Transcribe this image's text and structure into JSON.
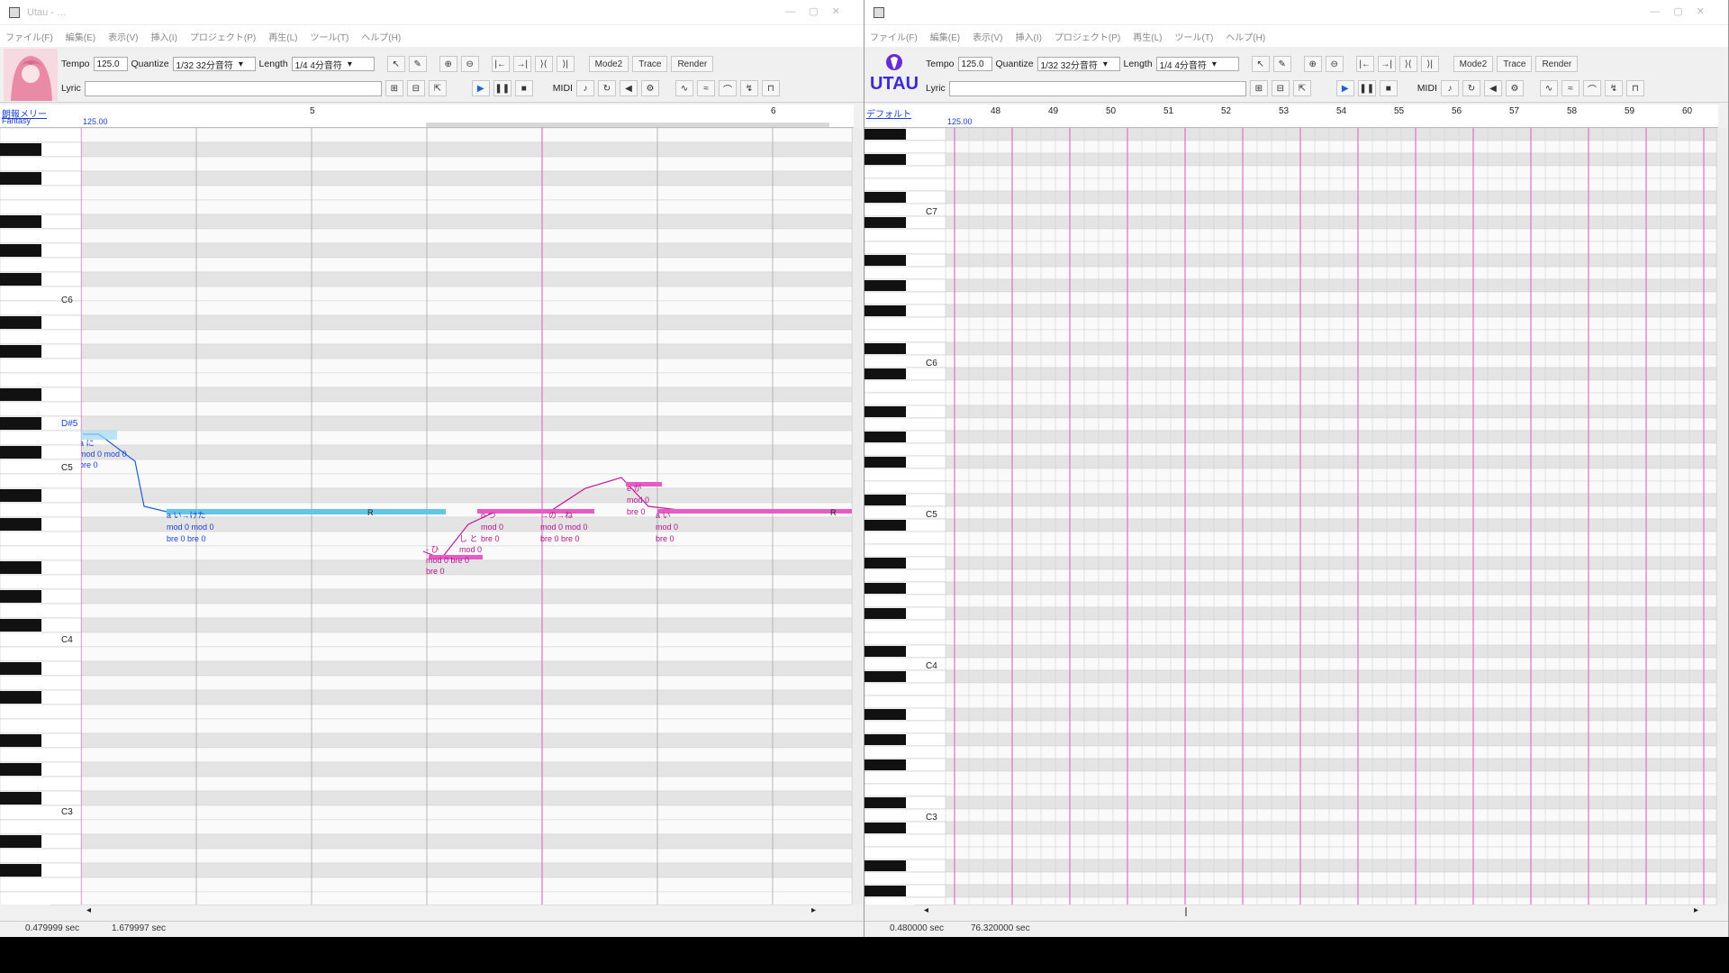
{
  "left": {
    "title": "Utau - …",
    "menu": [
      "ファイル(F)",
      "編集(E)",
      "表示(V)",
      "挿入(I)",
      "プロジェクト(P)",
      "再生(L)",
      "ツール(T)",
      "ヘルプ(H)"
    ],
    "tempo_label": "Tempo",
    "tempo": "125.0",
    "quantize_label": "Quantize",
    "quantize": "1/32 32分音符",
    "length_label": "Length",
    "length": "1/4 4分音符",
    "lyric_label": "Lyric",
    "mode2": "Mode2",
    "trace": "Trace",
    "render": "Render",
    "midi": "MIDI",
    "track_name": "朗報メリー",
    "track_sub": "Fantasy",
    "tempo_marker": "125.00",
    "measures": [
      "5",
      "6"
    ],
    "keys": [
      "C6",
      "D#5",
      "C5",
      "C4",
      "C3"
    ],
    "notes": [
      {
        "lyric": "a に",
        "mods": "mod 0 mod 0",
        "bre": "bre 0"
      },
      {
        "lyric": "a い→けた",
        "mods": "mod 0 mod 0",
        "bre": "bre 0 bre 0"
      },
      {
        "lyric": "R"
      },
      {
        "lyric": "- ひ",
        "mods": "mod 0 bre 0",
        "bre": "bre 0"
      },
      {
        "lyric": "し と",
        "mods": "mod 0",
        "bre": ""
      },
      {
        "lyric": "o つ",
        "mods": "mod 0",
        "bre": "bre 0"
      },
      {
        "lyric": "→の→ね",
        "mods": "mod 0 mod 0",
        "bre": "bre 0 bre 0"
      },
      {
        "lyric": "e が",
        "mods": "mod 0",
        "bre": "bre 0"
      },
      {
        "lyric": "a い",
        "mods": "mod 0",
        "bre": "bre 0"
      },
      {
        "lyric": "R"
      }
    ],
    "status_left": "0.479999 sec",
    "status_right": "1.679997 sec"
  },
  "right": {
    "title": "",
    "menu": [
      "ファイル(F)",
      "編集(E)",
      "表示(V)",
      "挿入(I)",
      "プロジェクト(P)",
      "再生(L)",
      "ツール(T)",
      "ヘルプ(H)"
    ],
    "logo": "UTAU",
    "tempo_label": "Tempo",
    "tempo": "125.0",
    "quantize_label": "Quantize",
    "quantize": "1/32 32分音符",
    "length_label": "Length",
    "length": "1/4 4分音符",
    "lyric_label": "Lyric",
    "mode2": "Mode2",
    "trace": "Trace",
    "render": "Render",
    "midi": "MIDI",
    "track_name": "デフォルト",
    "tempo_marker": "125.00",
    "measures": [
      "48",
      "49",
      "50",
      "51",
      "52",
      "53",
      "54",
      "55",
      "56",
      "57",
      "58",
      "59",
      "60"
    ],
    "keys": [
      "C7",
      "C6",
      "C5",
      "C4",
      "C3"
    ],
    "status_left": "0.480000 sec",
    "status_right": "76.320000 sec"
  }
}
